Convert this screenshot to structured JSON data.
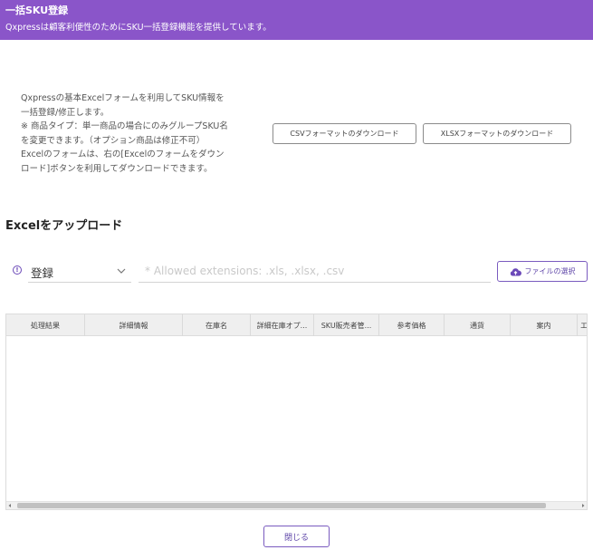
{
  "header": {
    "title": "一括SKU登録",
    "subtitle": "Qxpressは顧客利便性のためにSKU一括登録機能を提供しています。"
  },
  "description": {
    "lines": [
      "Qxpressの基本Excelフォームを利用してSKU情報を",
      "一括登録/修正します。",
      "※ 商品タイプ：単一商品の場合にのみグループSKU名",
      "を変更できます。（オプション商品は修正不可）",
      "Excelのフォームは、右の[Excelのフォームをダウン",
      "ロード]ボタンを利用してダウンロードできます。"
    ]
  },
  "downloads": {
    "csv_label": "CSVフォーマットのダウンロード",
    "xlsx_label": "XLSXフォーマットのダウンロード"
  },
  "upload": {
    "section_title": "Excelをアップロード",
    "info_icon": "info-icon",
    "mode_value": "登録",
    "file_placeholder": "* Allowed extensions: .xls, .xlsx, .csv",
    "select_file_label": "ファイルの選択",
    "select_file_icon": "cloud-upload-icon"
  },
  "grid": {
    "columns": [
      "処理結果",
      "詳細情報",
      "在庫名",
      "詳細在庫オプ...",
      "SKU販売者管...",
      "参考価格",
      "通貨",
      "案内",
      "エ"
    ]
  },
  "footer": {
    "close_label": "閉じる"
  },
  "colors": {
    "header_bg": "#8a55c9",
    "accent": "#6b49b8"
  }
}
